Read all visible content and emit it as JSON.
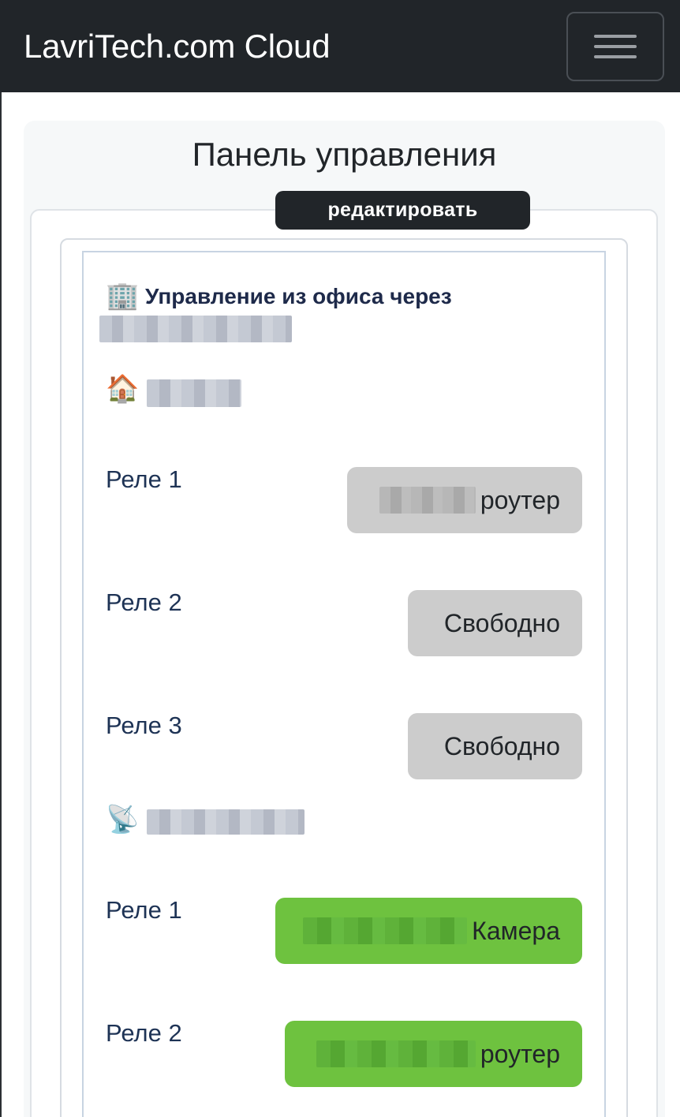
{
  "navbar": {
    "brand": "LavriTech.com Cloud",
    "menu_icon": "hamburger-menu-icon"
  },
  "panel": {
    "title": "Панель управления",
    "edit_label": "редактировать"
  },
  "office": {
    "icon": "🏢",
    "icon_name": "office-building-icon",
    "title": "Управление из офиса через"
  },
  "devices": [
    {
      "icon": "🏠",
      "icon_name": "house-icon",
      "relays": [
        {
          "label": "Реле 1",
          "state_label": "роутер",
          "state": "off"
        },
        {
          "label": "Реле 2",
          "state_label": "Свободно",
          "state": "off"
        },
        {
          "label": "Реле 3",
          "state_label": "Свободно",
          "state": "off"
        }
      ]
    },
    {
      "icon": "📡",
      "icon_name": "satellite-dish-icon",
      "relays": [
        {
          "label": "Реле 1",
          "state_label": "Камера",
          "state": "on"
        },
        {
          "label": "Реле 2",
          "state_label": "роутер",
          "state": "on"
        }
      ]
    }
  ],
  "colors": {
    "navbar_bg": "#212529",
    "relay_off": "#cccccc",
    "relay_on": "#6ec23f",
    "label_text": "#1e3355"
  }
}
